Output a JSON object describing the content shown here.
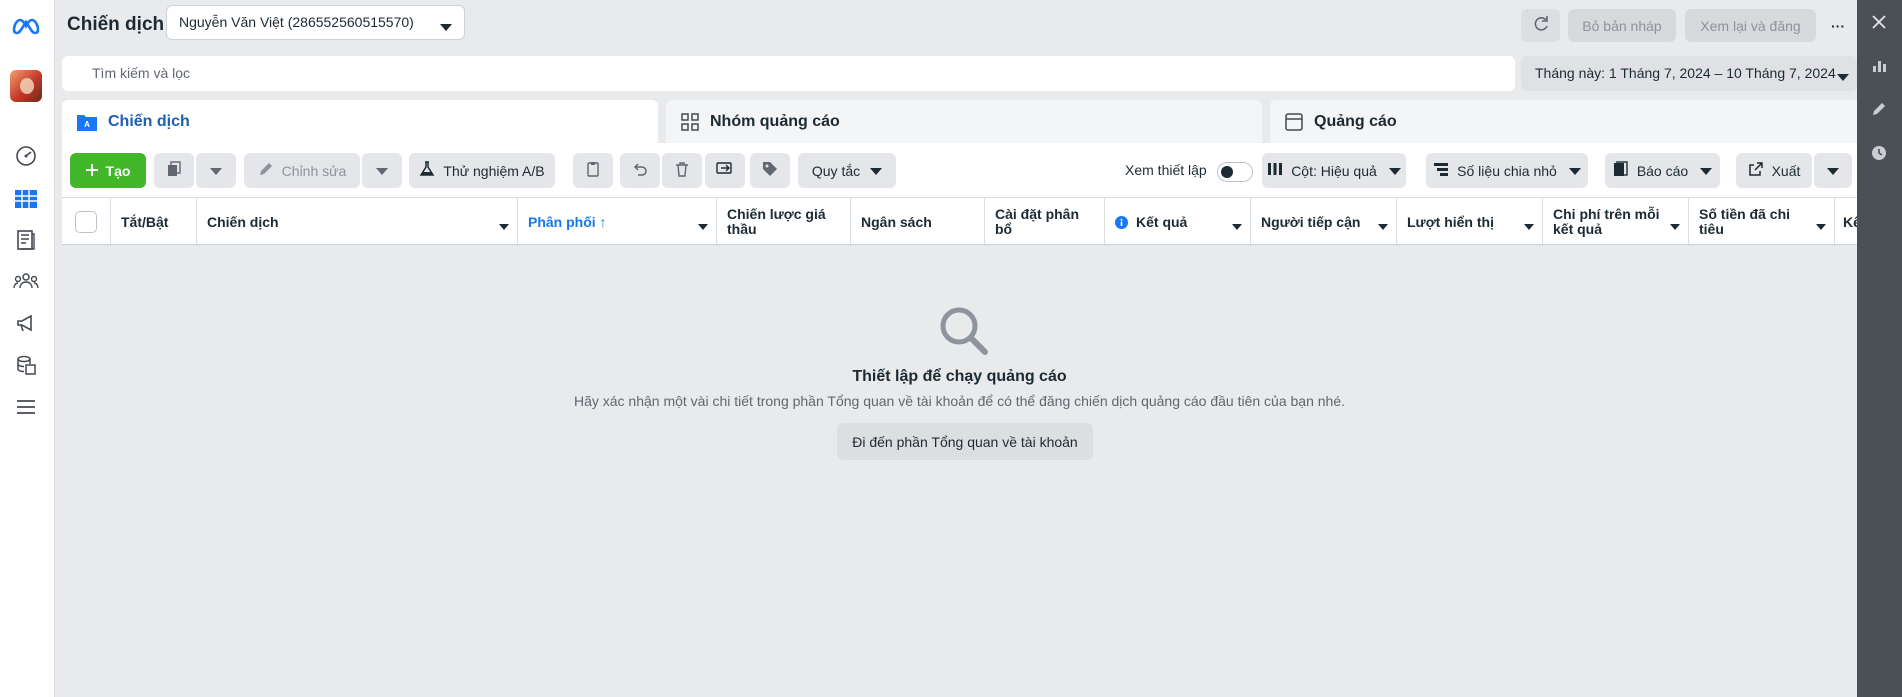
{
  "header": {
    "title": "Chiến dịch",
    "account_selector": "Nguyễn Văn Việt (286552560515570)",
    "discard_drafts_label": "Bỏ bản nháp",
    "review_publish_label": "Xem lại và đăng",
    "more_label": "···"
  },
  "search": {
    "placeholder": "Tìm kiếm và lọc",
    "date_range": "Tháng này: 1 Tháng 7, 2024 – 10 Tháng 7, 2024"
  },
  "tabs": [
    {
      "label": "Chiến dịch",
      "active": true
    },
    {
      "label": "Nhóm quảng cáo",
      "active": false
    },
    {
      "label": "Quảng cáo",
      "active": false
    }
  ],
  "toolbar": {
    "create_label": "Tạo",
    "edit_label": "Chỉnh sửa",
    "ab_test_label": "Thử nghiệm A/B",
    "rules_label": "Quy tắc",
    "view_setup_label": "Xem thiết lập",
    "columns_label": "Cột: Hiệu quả",
    "breakdown_label": "Số liệu chia nhỏ",
    "reports_label": "Báo cáo",
    "export_label": "Xuất"
  },
  "table": {
    "columns": [
      "Tắt/Bật",
      "Chiến dịch",
      "Phân phối ↑",
      "Chiến lược giá thầu",
      "Ngân sách",
      "Cài đặt phân bổ",
      "Kết quả",
      "Người tiếp cận",
      "Lượt hiển thị",
      "Chi phí trên mỗi kết quả",
      "Số tiền đã chi tiêu",
      "Kế"
    ]
  },
  "empty_state": {
    "title": "Thiết lập để chạy quảng cáo",
    "description": "Hãy xác nhận một vài chi tiết trong phần Tổng quan về tài khoản để có thể đăng chiến dịch quảng cáo đầu tiên của bạn nhé.",
    "button_label": "Đi đến phần Tổng quan về tài khoản"
  },
  "colors": {
    "accent": "#1877f2",
    "create_green": "#42b72a",
    "right_rail": "#4b4f56"
  }
}
